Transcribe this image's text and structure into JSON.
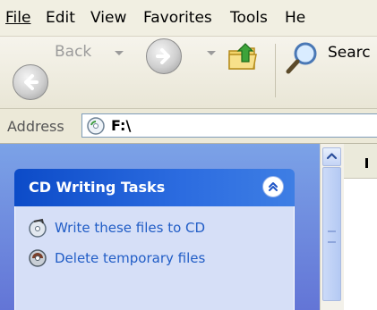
{
  "menubar": {
    "items": [
      {
        "label": "File"
      },
      {
        "label": "Edit"
      },
      {
        "label": "View"
      },
      {
        "label": "Favorites"
      },
      {
        "label": "Tools"
      },
      {
        "label": "He"
      }
    ]
  },
  "toolbar": {
    "back_label": "Back",
    "search_label": "Searc",
    "icons": [
      "back-arrow-icon",
      "forward-arrow-icon",
      "folder-up-icon",
      "search-magnifier-icon"
    ]
  },
  "address": {
    "label": "Address",
    "value": "F:\\"
  },
  "task_pane": {
    "title": "CD Writing Tasks",
    "links": [
      {
        "label": "Write these files to CD",
        "icon": "write-cd-icon"
      },
      {
        "label": "Delete temporary files",
        "icon": "delete-temp-files-icon"
      }
    ]
  },
  "colors": {
    "task_header": "#0c4bc8",
    "task_body": "#d6dff7",
    "link_text": "#215dc6",
    "pane_gradient_top": "#7ba2e7",
    "pane_gradient_bottom": "#6375d6"
  }
}
